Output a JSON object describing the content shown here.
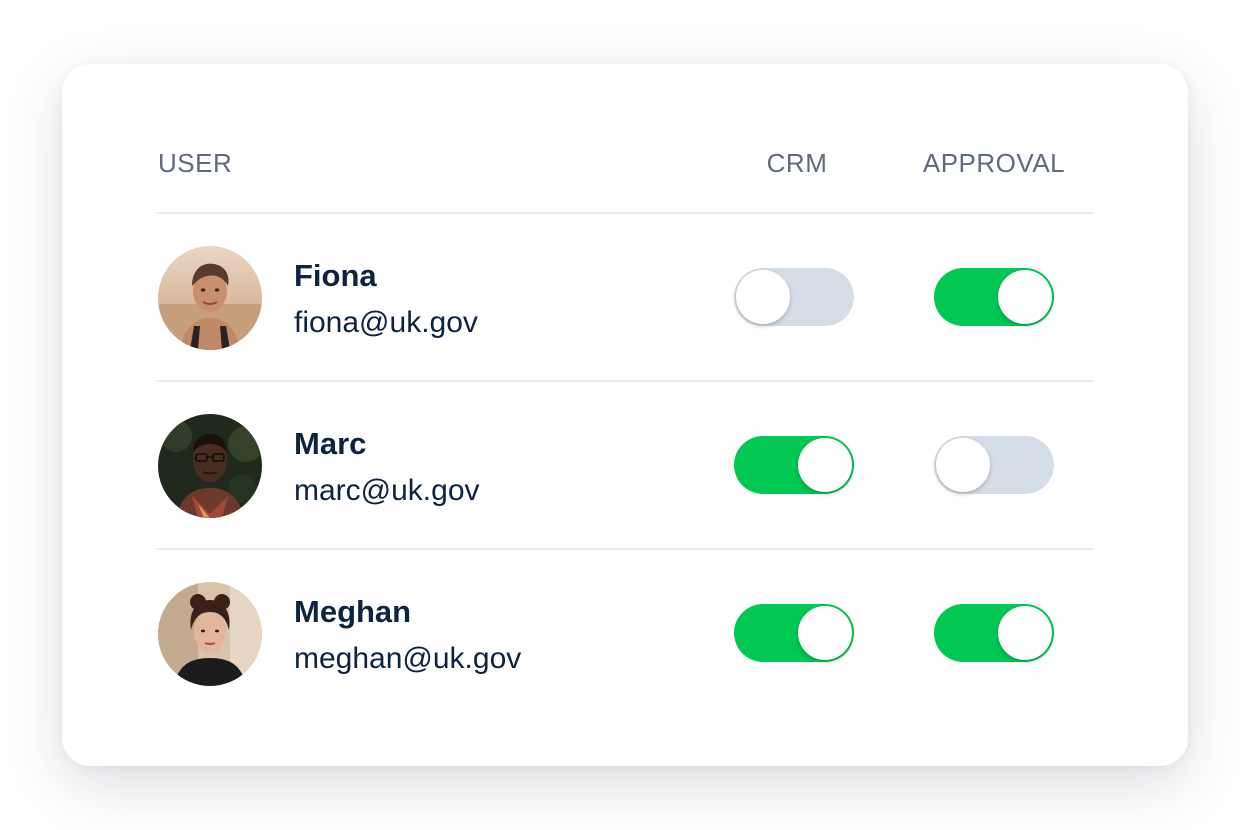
{
  "table": {
    "columns": {
      "user": "USER",
      "crm": "CRM",
      "approval": "APPROVAL"
    },
    "rows": [
      {
        "name": "Fiona",
        "email": "fiona@uk.gov",
        "crm": false,
        "approval": true
      },
      {
        "name": "Marc",
        "email": "marc@uk.gov",
        "crm": true,
        "approval": false
      },
      {
        "name": "Meghan",
        "email": "meghan@uk.gov",
        "crm": true,
        "approval": true
      }
    ]
  },
  "colors": {
    "toggle_on": "#00c853",
    "toggle_off": "#d5dde7",
    "text_primary": "#0d2340",
    "text_header": "#5f6b7c"
  }
}
